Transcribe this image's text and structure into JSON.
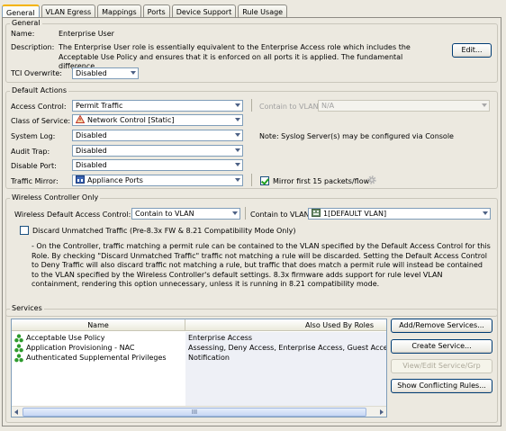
{
  "tabs": [
    "General",
    "VLAN Egress",
    "Mappings",
    "Ports",
    "Device Support",
    "Rule Usage"
  ],
  "general": {
    "legend": "General",
    "name_label": "Name:",
    "name_value": "Enterprise User",
    "description_label": "Description:",
    "description_text": "The Enterprise User role is essentially equivalent to the Enterprise Access role which includes the Acceptable Use Policy and ensures that it is enforced on all ports it is applied. The fundamental difference...",
    "edit_button": "Edit...",
    "tci_label": "TCI Overwrite:",
    "tci_value": "Disabled"
  },
  "default_actions": {
    "legend": "Default Actions",
    "access_control_label": "Access Control:",
    "access_control_value": "Permit Traffic",
    "contain_vlan_label": "Contain to VLAN:",
    "contain_vlan_value": "N/A",
    "class_of_service_label": "Class of Service:",
    "class_of_service_value": "Network Control [Static]",
    "system_log_label": "System Log:",
    "system_log_value": "Disabled",
    "syslog_note": "Note: Syslog Server(s) may be configured via Console",
    "audit_trap_label": "Audit Trap:",
    "audit_trap_value": "Disabled",
    "disable_port_label": "Disable Port:",
    "disable_port_value": "Disabled",
    "traffic_mirror_label": "Traffic Mirror:",
    "traffic_mirror_value": "Appliance Ports",
    "mirror_checkbox_label": "Mirror first 15 packets/flow",
    "mirror_checked": true
  },
  "wireless": {
    "legend": "Wireless Controller Only",
    "default_access_label": "Wireless Default Access Control:",
    "default_access_value": "Contain to VLAN",
    "contain_vlan_label": "Contain to VLAN:",
    "contain_vlan_value": "1[DEFAULT VLAN]",
    "discard_label": "Discard Unmatched Traffic (Pre-8.3x FW & 8.21 Compatibility Mode Only)",
    "discard_checked": false,
    "info_text": "- On the Controller, traffic matching a permit rule can be contained to the VLAN specified by the Default Access Control for this Role. By checking \"Discard Unmatched Traffic\" traffic not matching a rule will be discarded. Setting the Default Access Control to Deny Traffic will also discard traffic not matching a rule, but traffic that does match a permit rule will instead be contained to the VLAN specified by the Wireless Controller's default settings.  8.3x firmware adds support for rule level VLAN containment, rendering this option unnecessary, unless it is running in 8.21 compatibility mode."
  },
  "services": {
    "legend": "Services",
    "columns": [
      "Name",
      "Also Used By Roles"
    ],
    "rows": [
      {
        "name": "Acceptable Use Policy",
        "roles": "Enterprise Access"
      },
      {
        "name": "Application Provisioning - NAC",
        "roles": "Assessing, Deny Access, Enterprise Access, Guest Access,"
      },
      {
        "name": "Authenticated Supplemental Privileges",
        "roles": "Notification"
      }
    ],
    "scroll_thumb": "III",
    "buttons": {
      "add_remove": "Add/Remove Services...",
      "create": "Create Service...",
      "view_edit": "View/Edit Service/Grp",
      "show_conflicting": "Show Conflicting Rules..."
    }
  },
  "colors": {
    "panel_bg": "#ece9e0",
    "selection_border": "#7f9db9",
    "service_icon": "#2e9b2e"
  },
  "icons": [
    "warning-triangle-icon",
    "network-ports-icon",
    "vlan-icon",
    "service-group-icon",
    "gear-icon"
  ]
}
